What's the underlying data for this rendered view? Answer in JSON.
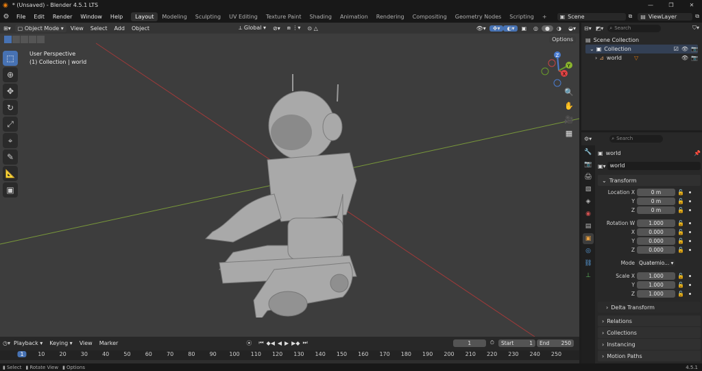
{
  "app": {
    "title": "* (Unsaved) - Blender 4.5.1 LTS"
  },
  "menu": [
    "File",
    "Edit",
    "Render",
    "Window",
    "Help"
  ],
  "workspaces": [
    "Layout",
    "Modeling",
    "Sculpting",
    "UV Editing",
    "Texture Paint",
    "Shading",
    "Animation",
    "Rendering",
    "Compositing",
    "Geometry Nodes",
    "Scripting"
  ],
  "workspace_add": "+",
  "scene": {
    "label": "Scene",
    "viewlayer": "ViewLayer"
  },
  "viewport_header": {
    "mode": "Object Mode",
    "view": "View",
    "select": "Select",
    "add": "Add",
    "object": "Object",
    "orientation": "Global",
    "options": "Options"
  },
  "viewport": {
    "perspective": "User Perspective",
    "collection": "(1) Collection | world"
  },
  "gizmo": {
    "z": "Z",
    "y": "Y",
    "x": "X"
  },
  "outliner": {
    "search_placeholder": "Search",
    "scene_collection": "Scene Collection",
    "collection": "Collection",
    "object": "world"
  },
  "properties": {
    "search_placeholder": "Search",
    "object_name": "world",
    "object_field": "world",
    "transform": "Transform",
    "location": {
      "label_x": "Location X",
      "label_y": "Y",
      "label_z": "Z",
      "x": "0 m",
      "y": "0 m",
      "z": "0 m"
    },
    "rotation": {
      "label_w": "Rotation W",
      "label_x": "X",
      "label_y": "Y",
      "label_z": "Z",
      "w": "1.000",
      "x": "0.000",
      "y": "0.000",
      "z": "0.000"
    },
    "mode": {
      "label": "Mode",
      "value": "Quaternio..."
    },
    "scale": {
      "label_x": "Scale X",
      "label_y": "Y",
      "label_z": "Z",
      "x": "1.000",
      "y": "1.000",
      "z": "1.000"
    },
    "delta": "Delta Transform",
    "sections": [
      "Relations",
      "Collections",
      "Instancing",
      "Motion Paths"
    ]
  },
  "timeline": {
    "playback": "Playback",
    "keying": "Keying",
    "view": "View",
    "marker": "Marker",
    "current_frame": "1",
    "start_label": "Start",
    "start": "1",
    "end_label": "End",
    "end": "250",
    "ruler": [
      "1",
      "10",
      "20",
      "30",
      "40",
      "50",
      "60",
      "70",
      "80",
      "90",
      "100",
      "110",
      "120",
      "130",
      "140",
      "150",
      "160",
      "170",
      "180",
      "190",
      "200",
      "210",
      "220",
      "230",
      "240",
      "250"
    ]
  },
  "status": {
    "select": "Select",
    "rotate": "Rotate View",
    "options": "Options",
    "version": "4.5.1"
  }
}
